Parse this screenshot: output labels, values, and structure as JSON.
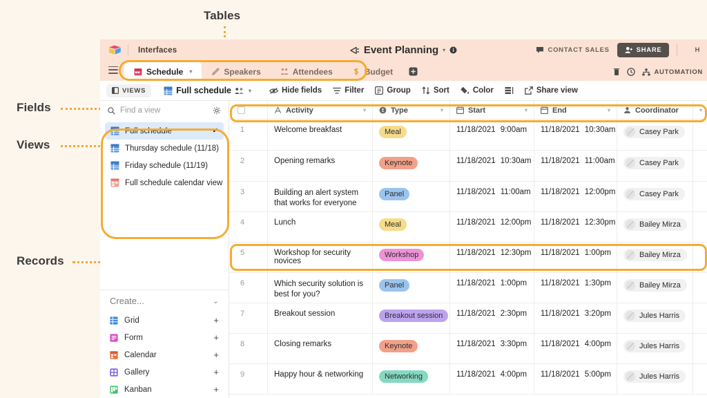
{
  "annotations": [
    {
      "label": "Tables",
      "name": "annotation-tables"
    },
    {
      "label": "Fields",
      "name": "annotation-fields"
    },
    {
      "label": "Views",
      "name": "annotation-views"
    },
    {
      "label": "Records",
      "name": "annotation-records"
    }
  ],
  "topbar": {
    "product": "Interfaces",
    "base_title": "Event Planning",
    "contact_sales": "CONTACT SALES",
    "share": "SHARE",
    "help": "H",
    "automation": "AUTOMATION"
  },
  "tabs": [
    {
      "label": "Schedule",
      "icon": "calendar-icon",
      "active": true
    },
    {
      "label": "Speakers",
      "icon": "pencil-icon",
      "active": false
    },
    {
      "label": "Attendees",
      "icon": "people-icon",
      "active": false
    },
    {
      "label": "Budget",
      "icon": "money-icon",
      "active": false
    }
  ],
  "toolbar": {
    "views_chip": "VIEWS",
    "view_name": "Full schedule",
    "items": [
      {
        "label": "Hide fields",
        "icon": "hide-fields-icon"
      },
      {
        "label": "Filter",
        "icon": "filter-icon"
      },
      {
        "label": "Group",
        "icon": "group-icon"
      },
      {
        "label": "Sort",
        "icon": "sort-icon"
      },
      {
        "label": "Color",
        "icon": "color-icon"
      },
      {
        "label": "",
        "icon": "row-height-icon"
      },
      {
        "label": "Share view",
        "icon": "share-view-icon"
      }
    ]
  },
  "sidebar": {
    "search_placeholder": "Find a view",
    "views": [
      {
        "label": "Full schedule",
        "icon": "grid-view-icon",
        "selected": true,
        "color": "#4f8fd8"
      },
      {
        "label": "Thursday schedule (11/18)",
        "icon": "grid-view-icon",
        "selected": false,
        "color": "#4f8fd8"
      },
      {
        "label": "Friday schedule (11/19)",
        "icon": "grid-view-icon",
        "selected": false,
        "color": "#4f8fd8"
      },
      {
        "label": "Full schedule calendar view",
        "icon": "calendar-view-icon",
        "selected": false,
        "color": "#e8736a"
      }
    ],
    "create_label": "Create...",
    "create_items": [
      {
        "label": "Grid",
        "icon": "grid-icon",
        "color": "#3b8ae2"
      },
      {
        "label": "Form",
        "icon": "form-icon",
        "color": "#d74fc4"
      },
      {
        "label": "Calendar",
        "icon": "calendar-icon",
        "color": "#ec6f3d"
      },
      {
        "label": "Gallery",
        "icon": "gallery-icon",
        "color": "#7b5ce0"
      },
      {
        "label": "Kanban",
        "icon": "kanban-icon",
        "color": "#43c16b"
      }
    ]
  },
  "grid": {
    "columns": [
      {
        "label": "Activity",
        "icon": "text-field-icon"
      },
      {
        "label": "Type",
        "icon": "single-select-icon"
      },
      {
        "label": "Start",
        "icon": "date-field-icon"
      },
      {
        "label": "End",
        "icon": "date-field-icon"
      },
      {
        "label": "Coordinator",
        "icon": "collaborator-field-icon"
      }
    ],
    "rows": [
      {
        "n": "1",
        "activity": "Welcome breakfast",
        "type": "Meal",
        "type_color": "#f6dc8a",
        "start_date": "11/18/2021",
        "start_time": "9:00am",
        "end_date": "11/18/2021",
        "end_time": "10:30am",
        "coordinator": "Casey Park"
      },
      {
        "n": "2",
        "activity": "Opening remarks",
        "type": "Keynote",
        "type_color": "#f3a08a",
        "start_date": "11/18/2021",
        "start_time": "10:30am",
        "end_date": "11/18/2021",
        "end_time": "11:00am",
        "coordinator": "Casey Park"
      },
      {
        "n": "3",
        "activity": "Building an alert system that works for everyone",
        "type": "Panel",
        "type_color": "#9ac4ed",
        "start_date": "11/18/2021",
        "start_time": "11:00am",
        "end_date": "11/18/2021",
        "end_time": "12:00pm",
        "coordinator": "Casey Park"
      },
      {
        "n": "4",
        "activity": "Lunch",
        "type": "Meal",
        "type_color": "#f6dc8a",
        "start_date": "11/18/2021",
        "start_time": "12:00pm",
        "end_date": "11/18/2021",
        "end_time": "12:30pm",
        "coordinator": "Bailey Mirza"
      },
      {
        "n": "5",
        "activity": "Workshop for security novices",
        "type": "Workshop",
        "type_color": "#ec93d6",
        "start_date": "11/18/2021",
        "start_time": "12:30pm",
        "end_date": "11/18/2021",
        "end_time": "1:00pm",
        "coordinator": "Bailey Mirza"
      },
      {
        "n": "6",
        "activity": "Which security solution is best for you?",
        "type": "Panel",
        "type_color": "#9ac4ed",
        "start_date": "11/18/2021",
        "start_time": "1:00pm",
        "end_date": "11/18/2021",
        "end_time": "1:30pm",
        "coordinator": "Bailey Mirza"
      },
      {
        "n": "7",
        "activity": "Breakout session",
        "type": "Breakout session",
        "type_color": "#bda3ee",
        "start_date": "11/18/2021",
        "start_time": "2:30pm",
        "end_date": "11/18/2021",
        "end_time": "3:20pm",
        "coordinator": "Jules Harris"
      },
      {
        "n": "8",
        "activity": "Closing remarks",
        "type": "Keynote",
        "type_color": "#f3a08a",
        "start_date": "11/18/2021",
        "start_time": "3:30pm",
        "end_date": "11/18/2021",
        "end_time": "4:00pm",
        "coordinator": "Jules Harris"
      },
      {
        "n": "9",
        "activity": "Happy hour & networking",
        "type": "Networking",
        "type_color": "#85d9c1",
        "start_date": "11/18/2021",
        "start_time": "4:00pm",
        "end_date": "11/18/2021",
        "end_time": "5:00pm",
        "coordinator": "Jules Harris"
      }
    ]
  },
  "colors": {
    "highlight": "#f5ab31",
    "page_bg": "#fdf6ec",
    "topbar_bg": "#fbe2d4",
    "selected_view_bg": "#dceaf9"
  }
}
